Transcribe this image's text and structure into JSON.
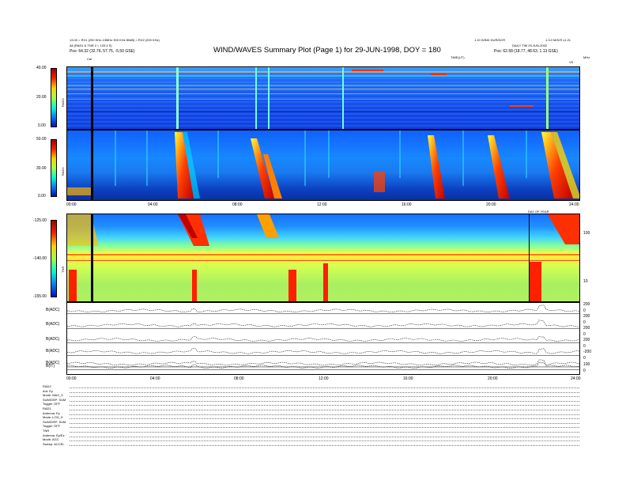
{
  "header": {
    "title": "WIND/WAVES Summary Plot (Page 1) for 29-JUN-1998, DOY = 180",
    "left_line1": "13.00 = RX1 (200 KHz-13MHz 300 KHz 80dB) = RX2 (200 KHz)",
    "left_line2": "All (RAD1 & TNR 2 = 133.3 S)",
    "left_pos": "Pos: 64.32 (32.76, 57.75, -5.50 GSE)",
    "right_line1": "1.10 WIND DUR/DCR",
    "right_version": "1.3.0 M/D/S v1.21",
    "right_daily": "DAILY TIM 29-JUN-2002",
    "right_pos": "Pos: 62.58 (18.77, 48.63, 1.13 GSE)",
    "cal_label": "Cal",
    "top_right_mhz": "MHz",
    "top_right_vs": "VS",
    "time_axis_mark": "TIME(UT)",
    "dd_label": "DAY OF YEAR"
  },
  "chart_data": [
    {
      "type": "heatmap",
      "name_label": "RAD2",
      "colorbar_ticks": [
        "40.00",
        "20.00",
        "0.00"
      ],
      "zlim": [
        0,
        40
      ]
    },
    {
      "type": "heatmap",
      "name_label": "RAD1",
      "colorbar_ticks": [
        "50.00",
        "30.00",
        "0.00"
      ],
      "zlim": [
        0,
        50
      ],
      "x_ticks": [
        "00:00",
        "04:00",
        "08:00",
        "12:00",
        "16:00",
        "20:00",
        "24:00"
      ]
    },
    {
      "type": "heatmap",
      "name_label": "TNR",
      "colorbar_ticks": [
        "-125.00",
        "-140.00",
        "-155.00"
      ],
      "zlim": [
        -155,
        -125
      ],
      "right_ticks": [
        "100",
        "10"
      ]
    },
    {
      "type": "line",
      "series": [
        {
          "name": "B(ADC)",
          "baseline": 0.15
        },
        {
          "name": "B(ADC)",
          "baseline": 0.35
        },
        {
          "name": "B(ADC)",
          "baseline": 0.55
        },
        {
          "name": "B(ADC)",
          "baseline": 0.72
        },
        {
          "name": "B(ADC)",
          "baseline": 0.88
        },
        {
          "name": "B(IT)",
          "baseline": 0.92
        }
      ],
      "right_ticks": [
        "200",
        "0",
        "200",
        "0",
        "200",
        "0",
        "200",
        "0",
        "-200",
        "0",
        "100",
        "0"
      ],
      "x_ticks": [
        "00:00",
        "04:00",
        "08:00",
        "12:00",
        "16:00",
        "20:00",
        "24:00"
      ]
    }
  ],
  "footer": {
    "rows": [
      "RAD2",
      "Ant: Ey",
      "Mode: MAX_S",
      "SUM/DSP: SUM",
      "Toggle: OFF",
      "RAD1",
      "Antenna: Ey",
      "Mode: LOG_S",
      "SUM/DSP: SUM",
      "Toggle: OFF",
      "TNR",
      "Antenna: Ey/Ez",
      "Mode: AGC",
      "Sweep: ACCEL"
    ]
  },
  "colors": {
    "bg_low": "#0a2fe0",
    "bg_mid": "#1aa8ff",
    "hot": "#ff2000",
    "warm": "#ffff00"
  }
}
